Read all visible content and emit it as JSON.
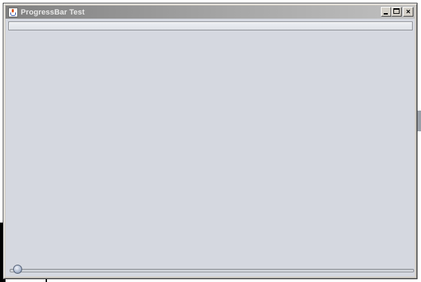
{
  "window": {
    "title": "ProgressBar Test",
    "icon": "java-cup-icon",
    "buttons": {
      "minimize_icon": "minimize-icon",
      "maximize_icon": "maximize-icon",
      "close_icon": "close-icon"
    }
  },
  "progressbar": {
    "value": 0
  },
  "slider": {
    "value": 0
  },
  "colors": {
    "titlebar_start": "#808080",
    "titlebar_end": "#c0c0c0",
    "content_bg": "#d5d8e0",
    "progress_fill": "#6c8cc6"
  }
}
